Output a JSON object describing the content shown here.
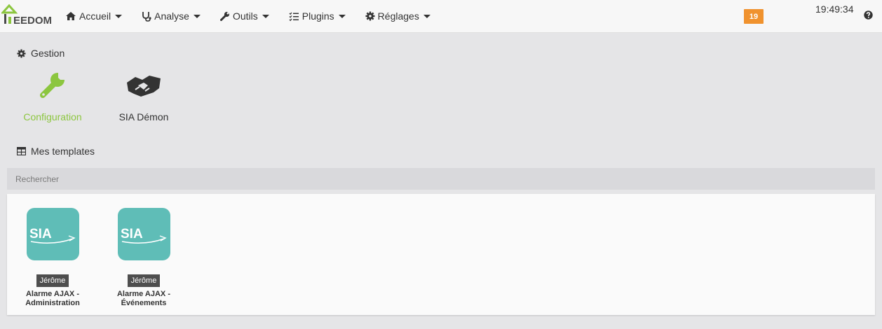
{
  "navbar": {
    "logo_text": "EEDOM",
    "menu": [
      {
        "label": "Accueil",
        "icon": "home-icon"
      },
      {
        "label": "Analyse",
        "icon": "stethoscope-icon"
      },
      {
        "label": "Outils",
        "icon": "wrench-icon"
      },
      {
        "label": "Plugins",
        "icon": "tasks-icon"
      },
      {
        "label": "Réglages",
        "icon": "gear-icon"
      }
    ],
    "badge": "19",
    "clock": "19:49:34",
    "help_icon": "question-circle-icon"
  },
  "gestion": {
    "title": "Gestion",
    "icon": "gear-icon",
    "items": [
      {
        "label": "Configuration",
        "icon": "wrench-icon",
        "color": "#8cc63f"
      },
      {
        "label": "SIA Démon",
        "icon": "handshake-icon",
        "color": "#333333"
      }
    ]
  },
  "templates": {
    "title": "Mes templates",
    "icon": "table-icon",
    "search_placeholder": "Rechercher",
    "items": [
      {
        "logo": "SIA",
        "author": "Jérôme",
        "name": "Alarme AJAX -\nAdministration"
      },
      {
        "logo": "SIA",
        "author": "Jérôme",
        "name": "Alarme AJAX -\nÉvénements"
      }
    ]
  },
  "colors": {
    "accent_green": "#8cc63f",
    "badge_orange": "#f0922e",
    "tile_teal": "#5fbdb7"
  }
}
